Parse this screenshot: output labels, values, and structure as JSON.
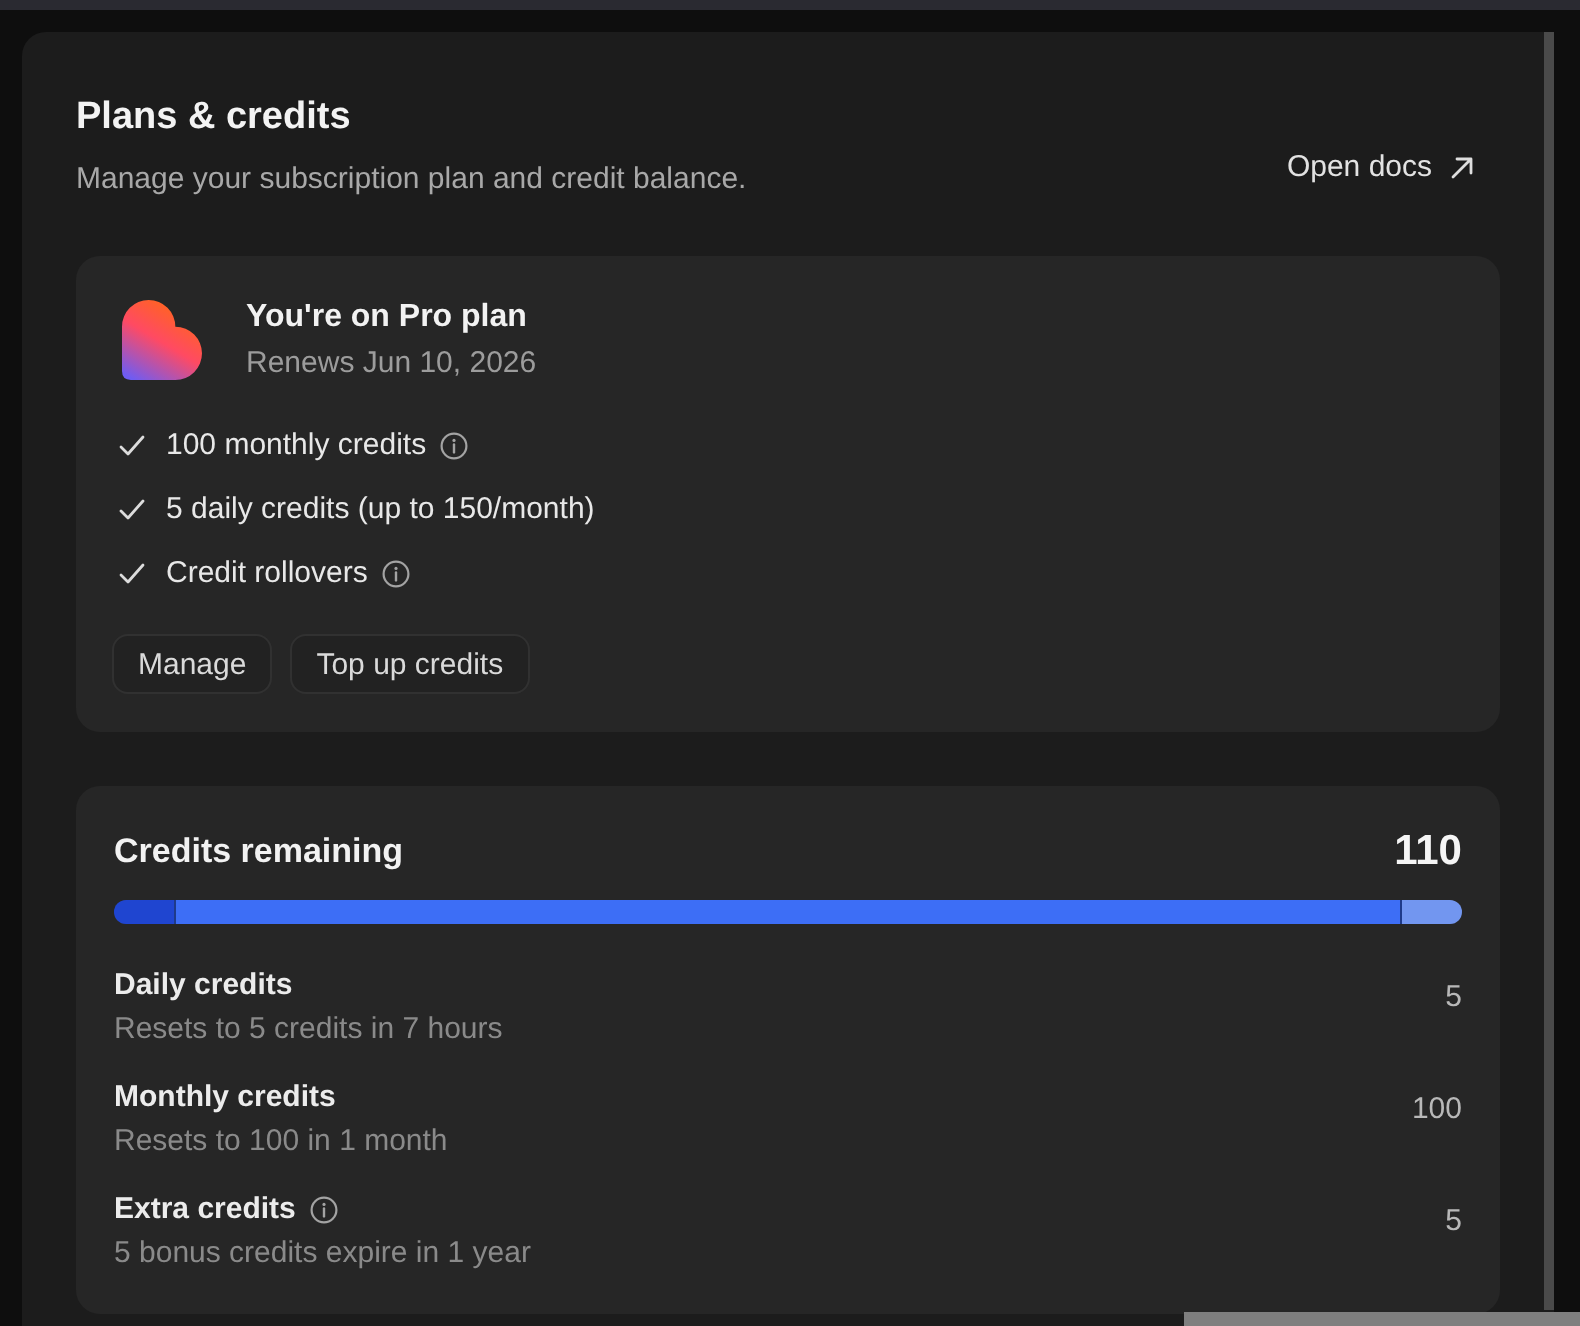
{
  "header": {
    "title": "Plans & credits",
    "subtitle": "Manage your subscription plan and credit balance.",
    "docs_link": "Open docs"
  },
  "plan": {
    "title": "You're on Pro plan",
    "renewal": "Renews Jun 10, 2026",
    "features": [
      {
        "text": "100 monthly credits",
        "info": true
      },
      {
        "text": "5 daily credits (up to 150/month)",
        "info": false
      },
      {
        "text": "Credit rollovers",
        "info": true
      }
    ],
    "buttons": [
      "Manage",
      "Top up credits"
    ]
  },
  "credits": {
    "title": "Credits remaining",
    "total": "110",
    "types": [
      {
        "name": "Daily credits",
        "info": false,
        "detail": "Resets to 5 credits in 7 hours",
        "value": "5",
        "level": 0.045,
        "color": "#1f45d0"
      },
      {
        "name": "Monthly credits",
        "info": false,
        "detail": "Resets to 100 in 1 month",
        "value": "100",
        "color": "#3d6ef6"
      },
      {
        "name": "Extra credits",
        "info": true,
        "detail": "5 bonus credits expire in 1 year",
        "value": "5",
        "level": 0.045,
        "color": "#7296f0"
      }
    ]
  }
}
